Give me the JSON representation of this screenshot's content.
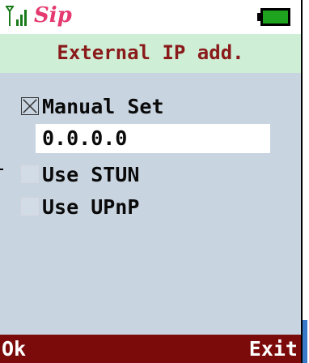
{
  "status": {
    "logo_text": "Sip",
    "signal_icon": "signal-strength-icon",
    "battery_icon": "battery-full-icon",
    "battery_level": 1.0,
    "colors": {
      "logo": "#e53a6f",
      "battery": "#1ea31e",
      "signal": "#1a7a1a"
    }
  },
  "title": {
    "text": "External IP add."
  },
  "options": {
    "manual": {
      "label": "Manual Set",
      "checked": true
    },
    "ip_value": "0.0.0.0",
    "stun": {
      "label": "Use STUN",
      "checked": false
    },
    "upnp": {
      "label": "Use UPnP",
      "checked": false
    }
  },
  "softkeys": {
    "left": "Ok",
    "right": "Exit"
  },
  "theme": {
    "screen_bg": "#c8d4e0",
    "title_bg": "#cfeed6",
    "title_fg": "#8a1a1a",
    "softkey_bg": "#7b0a0a"
  }
}
